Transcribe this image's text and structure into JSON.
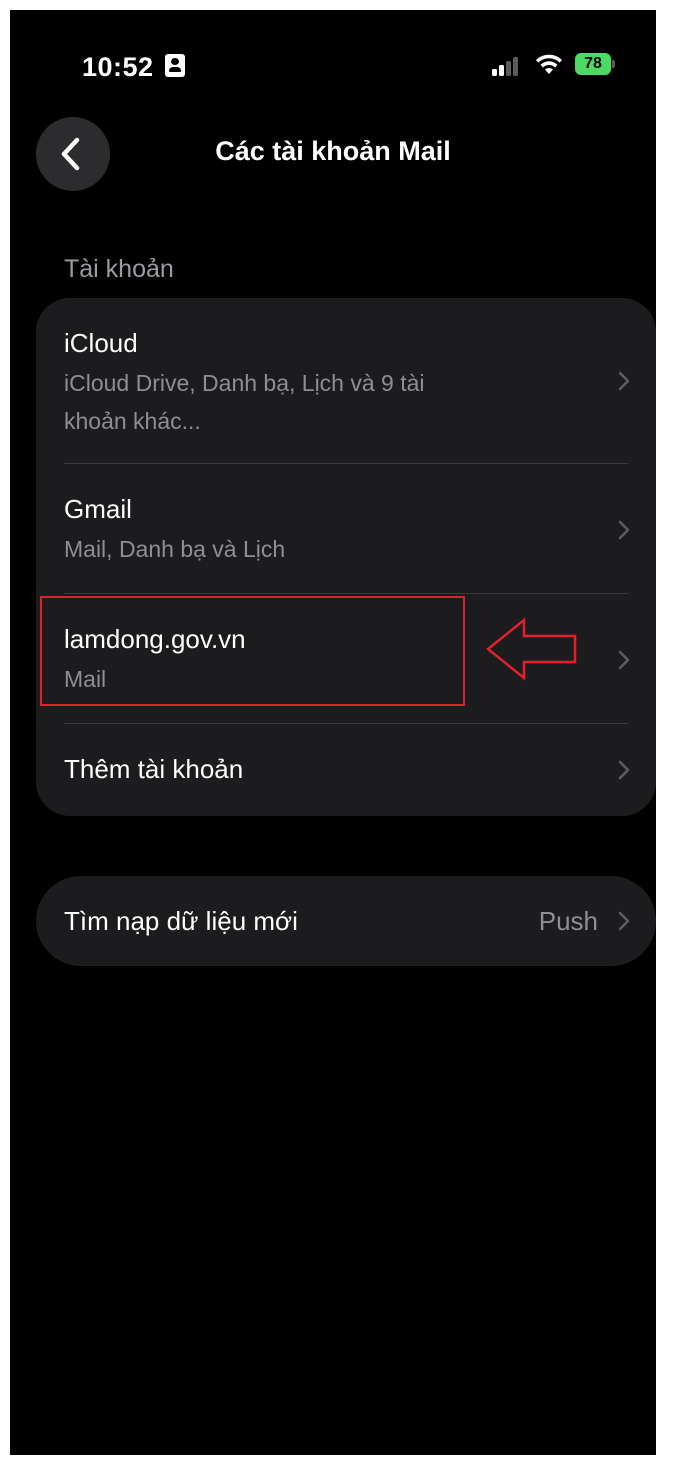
{
  "status_bar": {
    "time": "10:52",
    "battery": "78",
    "battery_color": "#4cd964"
  },
  "nav": {
    "back_icon": "chevron-left-icon",
    "title": "Các tài khoản Mail"
  },
  "accounts_section": {
    "header": "Tài khoản",
    "items": [
      {
        "title": "iCloud",
        "subtitle_line1": "iCloud Drive, Danh bạ, Lịch và 9 tài",
        "subtitle_line2": "khoản khác..."
      },
      {
        "title": "Gmail",
        "subtitle": "Mail, Danh bạ và Lịch"
      },
      {
        "title": "lamdong.gov.vn",
        "subtitle": "Mail"
      },
      {
        "title": "Thêm tài khoản"
      }
    ]
  },
  "fetch": {
    "label": "Tìm nạp dữ liệu mới",
    "value": "Push"
  },
  "annotation": {
    "color": "#e0212b",
    "arrow_icon": "left-arrow-outline-icon"
  }
}
